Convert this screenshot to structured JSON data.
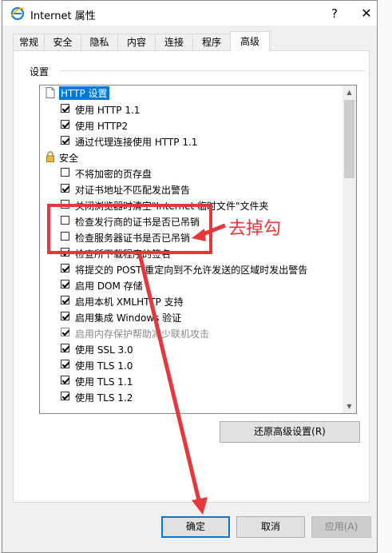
{
  "window": {
    "title": "Internet 属性",
    "help_glyph": "?",
    "close_glyph": "✕"
  },
  "tabs": [
    {
      "label": "常规",
      "active": false
    },
    {
      "label": "安全",
      "active": false
    },
    {
      "label": "隐私",
      "active": false
    },
    {
      "label": "内容",
      "active": false
    },
    {
      "label": "连接",
      "active": false
    },
    {
      "label": "程序",
      "active": false
    },
    {
      "label": "高级",
      "active": true
    }
  ],
  "settings": {
    "group_label": "设置",
    "rows": [
      {
        "type": "category",
        "icon": "page-icon",
        "label": "HTTP 设置",
        "selected": true
      },
      {
        "type": "checkbox",
        "label": "使用 HTTP 1.1",
        "checked": true
      },
      {
        "type": "checkbox",
        "label": "使用 HTTP2",
        "checked": true
      },
      {
        "type": "checkbox",
        "label": "通过代理连接使用 HTTP 1.1",
        "checked": true
      },
      {
        "type": "category",
        "icon": "lock-icon",
        "label": "安全"
      },
      {
        "type": "checkbox",
        "label": "不将加密的页存盘",
        "checked": false
      },
      {
        "type": "checkbox",
        "label": "对证书地址不匹配发出警告",
        "checked": true
      },
      {
        "type": "checkbox",
        "label": "关闭浏览器时清空\"Internet 临时文件\"文件夹",
        "checked": false
      },
      {
        "type": "checkbox",
        "label": "检查发行商的证书是否已吊销",
        "checked": false
      },
      {
        "type": "checkbox",
        "label": "检查服务器证书是否已吊销",
        "checked": false
      },
      {
        "type": "checkbox",
        "label": "检查所下载程序的签名",
        "checked": true
      },
      {
        "type": "checkbox",
        "label": "将提交的 POST 重定向到不允许发送的区域时发出警告",
        "checked": true
      },
      {
        "type": "checkbox",
        "label": "启用 DOM 存储",
        "checked": true
      },
      {
        "type": "checkbox",
        "label": "启用本机 XMLHTTP 支持",
        "checked": true
      },
      {
        "type": "checkbox",
        "label": "启用集成 Windows 验证",
        "checked": true
      },
      {
        "type": "checkbox",
        "label": "启用内存保护帮助减少联机攻击",
        "checked": true,
        "disabled": true
      },
      {
        "type": "checkbox",
        "label": "使用 SSL 3.0",
        "checked": true
      },
      {
        "type": "checkbox",
        "label": "使用 TLS 1.0",
        "checked": true
      },
      {
        "type": "checkbox",
        "label": "使用 TLS 1.1",
        "checked": true
      },
      {
        "type": "checkbox",
        "label": "使用 TLS 1.2",
        "checked": true
      }
    ],
    "scroll_position": 0
  },
  "buttons": {
    "restore_advanced": "还原高级设置(R)",
    "ok": "确定",
    "cancel": "取消",
    "apply": "应用(A)"
  },
  "annotation": {
    "text": "去掉勾",
    "color": "#e8373a"
  }
}
